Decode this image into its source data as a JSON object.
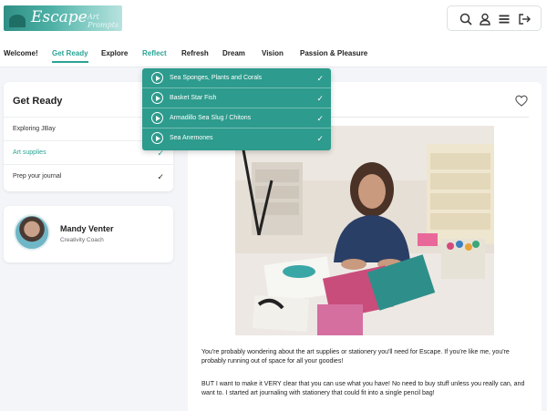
{
  "brand": {
    "logo_text": "Escape",
    "logo_subtext": "Art Prompts"
  },
  "nav": {
    "items": [
      "Welcome!",
      "Get Ready",
      "Explore",
      "Reflect",
      "Refresh",
      "Dream",
      "Vision",
      "Passion & Pleasure"
    ],
    "active": "Get Ready",
    "hover": "Reflect"
  },
  "dropdown": {
    "items": [
      {
        "label": "Sea Sponges, Plants and Corals",
        "completed": true
      },
      {
        "label": "Basket Star Fish",
        "completed": true
      },
      {
        "label": "Armadillo Sea Slug / Chitons",
        "completed": true
      },
      {
        "label": "Sea Anemones",
        "completed": true
      }
    ]
  },
  "sidebar": {
    "title": "Get Ready",
    "items": [
      {
        "label": "Exploring JBay",
        "completed": false,
        "active": false
      },
      {
        "label": "Art supplies",
        "completed": true,
        "active": true
      },
      {
        "label": "Prep your journal",
        "completed": true,
        "active": false
      }
    ]
  },
  "coach": {
    "name": "Mandy Venter",
    "role": "Creativity Coach"
  },
  "content": {
    "paragraph1": "You're probably wondering about the art supplies or stationery you'll need for Escape.  If you're like me, you're probably running out of space for all your goodies!",
    "paragraph2": "BUT I want to make it VERY clear that you can use what you have! No need to buy stuff unless you really can, and want to. I started art journaling with stationery that could fit into a single pencil bag!"
  },
  "icons": [
    "search-icon",
    "user-icon",
    "menu-icon",
    "logout-icon",
    "heart-icon",
    "play-circle-icon",
    "check-icon"
  ],
  "colors": {
    "accent": "#2aa394",
    "dropdown_bg": "#2d9b8d"
  }
}
